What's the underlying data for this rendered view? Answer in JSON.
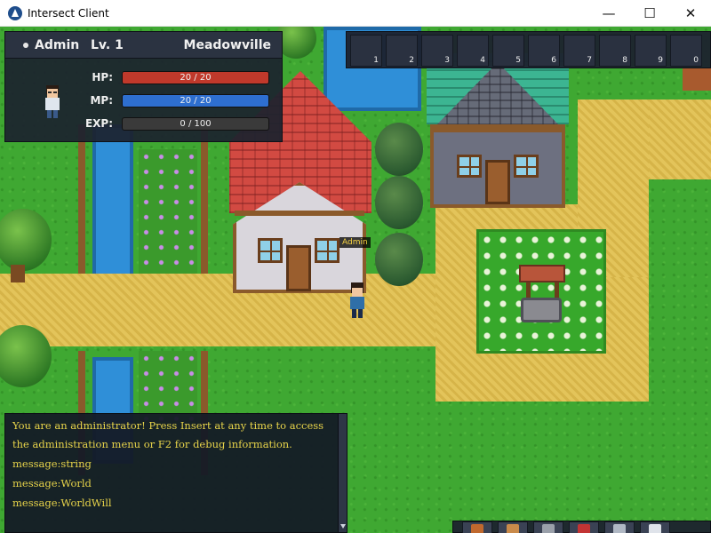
{
  "window": {
    "title": "Intersect Client",
    "minimize_glyph": "—",
    "maximize_glyph": "☐",
    "close_glyph": "✕"
  },
  "player_box": {
    "name": "Admin",
    "level": "Lv. 1",
    "map_name": "Meadowville",
    "stats": [
      {
        "label": "HP:",
        "text": "20 / 20",
        "fill_fraction": 1.0,
        "color": "#c0392b"
      },
      {
        "label": "MP:",
        "text": "20 / 20",
        "fill_fraction": 1.0,
        "color": "#2e6fd0"
      },
      {
        "label": "EXP:",
        "text": "0 / 100",
        "fill_fraction": 0.0,
        "color": "#6b6b6b"
      }
    ]
  },
  "hotbar": {
    "keys": [
      "1",
      "2",
      "3",
      "4",
      "5",
      "6",
      "7",
      "8",
      "9",
      "0"
    ]
  },
  "character": {
    "nameplate": "Admin"
  },
  "chat": {
    "lines": [
      "You are an administrator! Press Insert at any time to access",
      "the administration menu or F2 for debug information.",
      "message:string",
      "message:World",
      "message:WorldWill"
    ]
  },
  "menu": {
    "icons": [
      "sword-icon",
      "scroll-icon",
      "bag-icon",
      "heart-icon",
      "people-icon",
      "gear-icon"
    ]
  },
  "colors": {
    "grass": "#3fa832",
    "path": "#e3c45a",
    "water": "#2f8fd8",
    "chat_text": "#e8d44a",
    "hud_bg": "#1c222e"
  }
}
